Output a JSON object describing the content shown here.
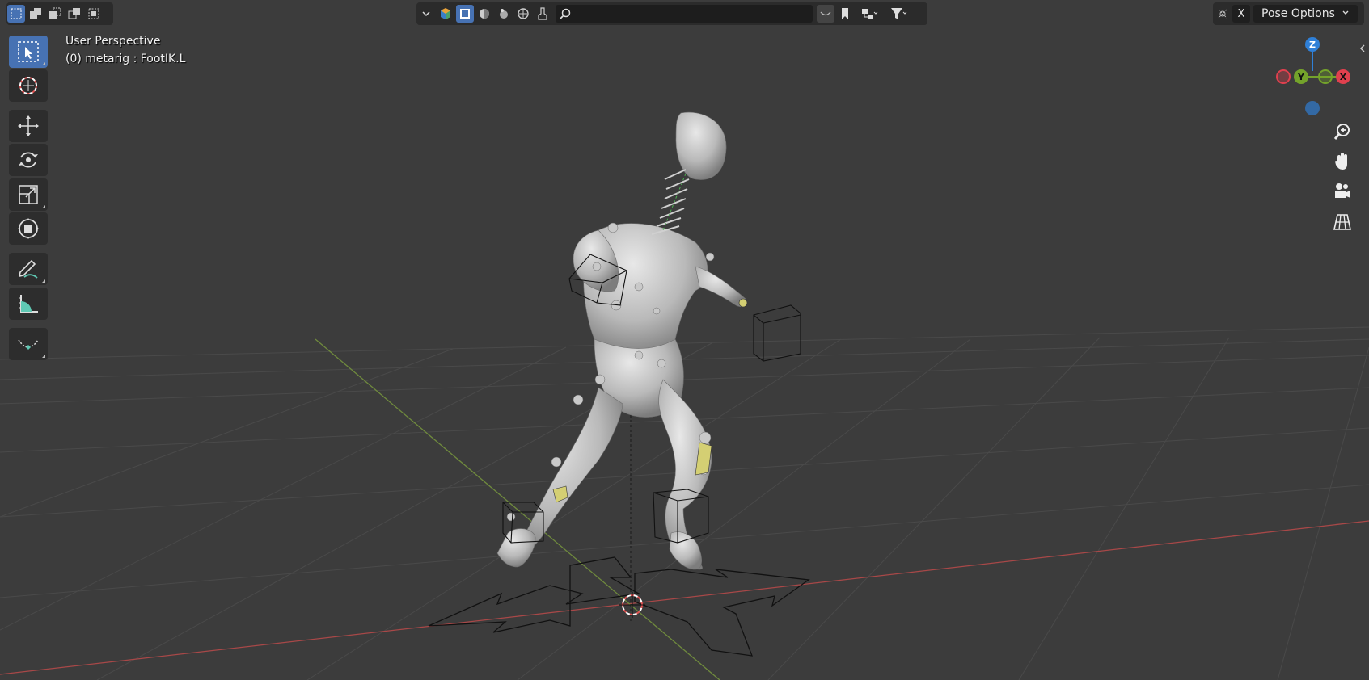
{
  "viewport": {
    "view_name": "User Perspective",
    "context": "(0) metarig : FootIK.L"
  },
  "header": {
    "search": {
      "value": "",
      "placeholder": ""
    },
    "pose_options_label": "Pose Options",
    "close_label": "X"
  },
  "gizmo": {
    "z": "Z",
    "y": "Y",
    "x": "X"
  },
  "icons": [
    "select-box-icon",
    "cursor-icon",
    "move-icon",
    "rotate-icon",
    "scale-icon",
    "transform-icon",
    "annotate-icon",
    "measure-icon",
    "pose-relax-icon",
    "zoom-icon",
    "pan-hand-icon",
    "camera-icon",
    "ortho-grid-icon"
  ],
  "colors": {
    "accent": "#4772b3",
    "axis_x": "#e0404e",
    "axis_y": "#74a32b",
    "axis_z": "#2f80d8"
  }
}
